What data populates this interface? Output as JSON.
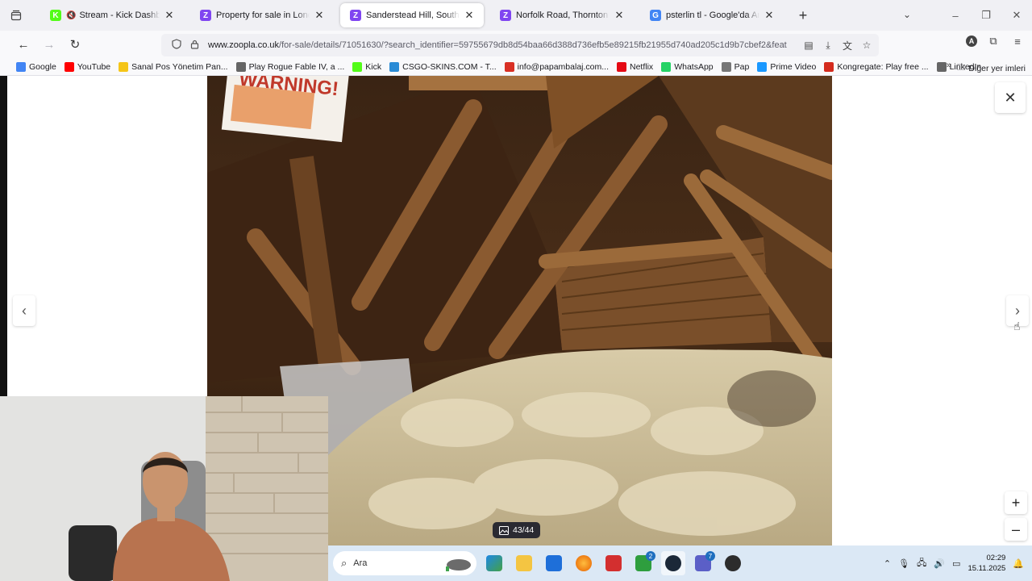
{
  "tabs": [
    {
      "title": "Stream - Kick Dashboard",
      "favicon": "kick-icon",
      "favicon_color": "#53fc18",
      "muted": true,
      "active": false
    },
    {
      "title": "Property for sale in London - Zo",
      "favicon": "zoopla-icon",
      "favicon_color": "#8046f1",
      "active": false
    },
    {
      "title": "Sanderstead Hill, South Croydo",
      "favicon": "zoopla-icon",
      "favicon_color": "#8046f1",
      "active": true
    },
    {
      "title": "Norfolk Road, Thornton Heath (",
      "favicon": "zoopla-icon",
      "favicon_color": "#8046f1",
      "active": false
    },
    {
      "title": "psterlin tl - Google'da Ara",
      "favicon": "google-icon",
      "favicon_color": "#4285f4",
      "active": false
    }
  ],
  "address_bar": {
    "domain": "www.zoopla.co.uk",
    "path": "/for-sale/details/71051630/?search_identifier=59755679db8d54baa66d388d736efb5e89215fb21955d740ad205c1d9b7cbef2&feat"
  },
  "bookmarks": [
    {
      "label": "Google",
      "icon": "google-icon",
      "color": "#4285f4"
    },
    {
      "label": "YouTube",
      "icon": "youtube-icon",
      "color": "#ff0000"
    },
    {
      "label": "Sanal Pos Yönetim Pan...",
      "icon": "folder-pos-icon",
      "color": "#f5c518"
    },
    {
      "label": "Play Rogue Fable IV, a ...",
      "icon": "globe-icon",
      "color": "#666666"
    },
    {
      "label": "Kick",
      "icon": "kick-icon",
      "color": "#53fc18"
    },
    {
      "label": "CSGO-SKINS.COM - T...",
      "icon": "csgo-icon",
      "color": "#2a8bd6"
    },
    {
      "label": "info@papambalaj.com...",
      "icon": "mail-icon",
      "color": "#d93025"
    },
    {
      "label": "Netflix",
      "icon": "netflix-icon",
      "color": "#e50914"
    },
    {
      "label": "WhatsApp",
      "icon": "whatsapp-icon",
      "color": "#25d366"
    },
    {
      "label": "Pap",
      "icon": "folder-icon",
      "color": "#777777"
    },
    {
      "label": "Prime Video",
      "icon": "prime-video-icon",
      "color": "#1a98ff"
    },
    {
      "label": "Kongregate: Play free ...",
      "icon": "kongregate-icon",
      "color": "#d42b1e"
    },
    {
      "label": "LinkedIn",
      "icon": "globe-icon",
      "color": "#666666"
    }
  ],
  "bookmarks_other": "Diğer yer imleri",
  "viewer": {
    "counter": "43/44",
    "warning_sign": "WARNING!"
  },
  "taskbar": {
    "search_placeholder": "Ara",
    "teams_badge": "7",
    "xbox_badge": "2",
    "time": "02:29",
    "date": "15.11.2025"
  }
}
